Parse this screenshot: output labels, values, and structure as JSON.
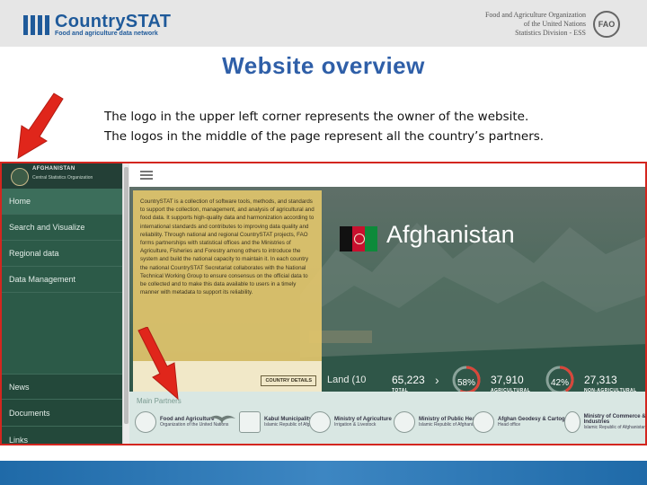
{
  "header": {
    "brand_name": "CountrySTAT",
    "brand_tagline": "Food and agriculture data network",
    "org_lines": [
      "Food and Agriculture Organization",
      "of the United Nations",
      "Statistics Division - ESS"
    ],
    "org_emblem": "FAO"
  },
  "slide": {
    "title": "Website overview",
    "lines": [
      "The logo in the upper left corner represents the owner of the website.",
      "The logos in the middle of the page represent all the country’s partners."
    ]
  },
  "site": {
    "org_name": "AFGHANISTAN",
    "org_subtitle": "Central Statistics Organization",
    "nav_top": [
      "Home",
      "Search and Visualize",
      "Regional data",
      "Data Management"
    ],
    "nav_bottom": [
      "News",
      "Documents",
      "Links"
    ],
    "active_nav": "Home",
    "country": "Afghanistan",
    "flag_colors": [
      "#111111",
      "#c8102e",
      "#0d8a3a"
    ],
    "intro_text": "CountrySTAT is a collection of software tools, methods, and standards to support the collection, management, and analysis of agricultural and food data. It supports high-quality data and harmonization according to international standards and contributes to improving data quality and reliability. Through national and regional CountrySTAT projects, FAO forms partnerships with statistical offices and the Ministries of Agriculture, Fisheries and Forestry among others to introduce the system and build the national capacity to maintain it. In each country the national CountrySTAT Secretariat collaborates with the National Technical Working Group to ensure consensus on the official data to be collected and to make this data available to users in a timely manner with metadata to support its reliability.",
    "country_details_button": "COUNTRY DETAILS",
    "stats": {
      "land_label": "Land (10",
      "total_value": "65,223",
      "total_label": "TOTAL",
      "ring1_pct": "58%",
      "agri_value": "37,910",
      "agri_label": "AGRICULTURAL",
      "ring2_pct": "42%",
      "nonagri_value": "27,313",
      "nonagri_label": "NON-AGRICULTURAL"
    },
    "partners_title": "Main Partners",
    "partners": [
      {
        "name": "Food and Agriculture",
        "sub": "Organization of the United Nations"
      },
      {
        "name": "",
        "sub": ""
      },
      {
        "name": "Kabul Municipality",
        "sub": "Islamic Republic of Afghanistan"
      },
      {
        "name": "Ministry of Agriculture",
        "sub": "Irrigation & Livestock"
      },
      {
        "name": "Ministry of Public Health",
        "sub": "Islamic Republic of Afghanistan"
      },
      {
        "name": "Afghan Geodesy & Cartography",
        "sub": "Head office"
      },
      {
        "name": "Ministry of Commerce & Industries",
        "sub": "Islamic Republic of Afghanistan"
      }
    ]
  },
  "colors": {
    "title_blue": "#2f5fa8",
    "arrow_red": "#e0261b",
    "sidebar_green": "#2c5a48",
    "info_yellow": "#e0c46c",
    "ring_red": "#d9463a"
  }
}
